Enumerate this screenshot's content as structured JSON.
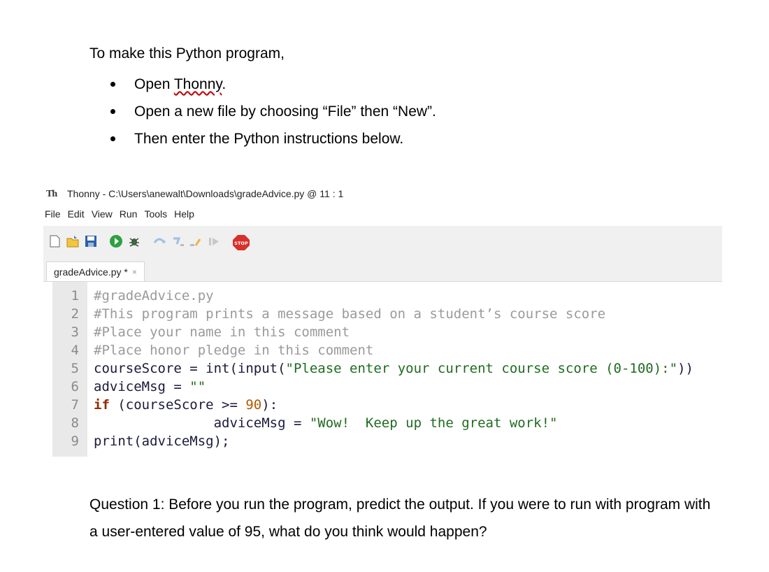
{
  "intro": {
    "lead": "To make this Python program,",
    "bullets": [
      {
        "pre": "Open ",
        "link": "Thonny",
        "post": "."
      },
      {
        "pre": "Open a new file by choosing “File” then “New”.",
        "link": "",
        "post": ""
      },
      {
        "pre": "Then enter the Python instructions below.",
        "link": "",
        "post": ""
      }
    ]
  },
  "window": {
    "title": "Thonny  -  C:\\Users\\anewalt\\Downloads\\gradeAdvice.py  @  11 : 1",
    "logo": "Th"
  },
  "menu": [
    "File",
    "Edit",
    "View",
    "Run",
    "Tools",
    "Help"
  ],
  "toolbar": {
    "buttons": [
      "new-file-icon",
      "open-file-icon",
      "save-icon",
      "run-icon",
      "debug-icon",
      "step-over-icon",
      "step-into-icon",
      "step-out-icon",
      "resume-icon",
      "stop-icon"
    ],
    "stop_label": "STOP"
  },
  "tab": {
    "label": "gradeAdvice.py *",
    "close": "×"
  },
  "code": {
    "line_numbers": [
      "1",
      "2",
      "3",
      "4",
      "5",
      "6",
      "7",
      "8",
      "9"
    ],
    "l1": "#gradeAdvice.py",
    "l2": "#This program prints a message based on a student’s course score",
    "l3": "#Place your name in this comment",
    "l4": "#Place honor pledge in this comment",
    "l5a": "courseScore = int(input(",
    "l5b": "\"Please enter your current course score (0-100):\"",
    "l5c": "))",
    "l6a": "adviceMsg = ",
    "l6b": "\"\"",
    "l7a": "if",
    "l7b": " (courseScore >= ",
    "l7c": "90",
    "l7d": "):",
    "l8a": "               adviceMsg = ",
    "l8b": "\"Wow!  Keep up the great work!\"",
    "l9": "print(adviceMsg);"
  },
  "question": "Question 1: Before you run the program, predict the output.  If you were to run with program with a user-entered value of 95, what do you think would happen?",
  "colors": {
    "toolbar_bg": "#f0f0f0",
    "gutter_bg": "#e9e9e9",
    "comment": "#9a9a9a",
    "string": "#1f6b1f",
    "keyword": "#8f2a00",
    "number": "#b05800"
  }
}
